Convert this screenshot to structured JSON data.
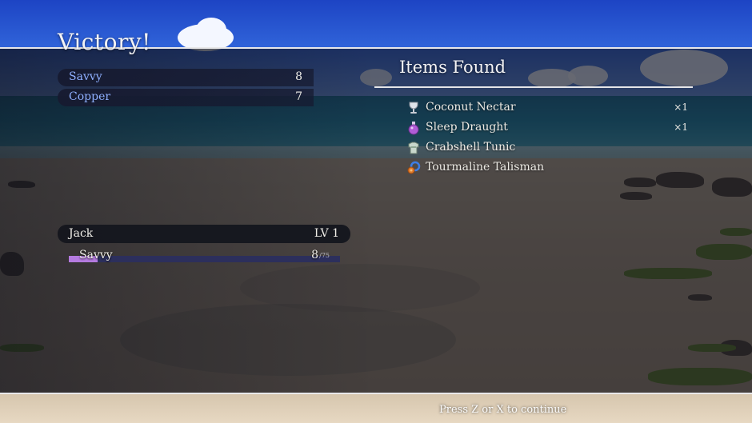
{
  "screen": {
    "title": "Victory!",
    "rewards": [
      {
        "label": "Savvy",
        "value": "8"
      },
      {
        "label": "Copper",
        "value": "7"
      }
    ],
    "items_found": {
      "title": "Items Found",
      "items": [
        {
          "name": "Coconut Nectar",
          "qty": "×1",
          "icon": "goblet-icon"
        },
        {
          "name": "Sleep Draught",
          "qty": "×1",
          "icon": "potion-icon"
        },
        {
          "name": "Crabshell Tunic",
          "qty": "",
          "icon": "armor-icon"
        },
        {
          "name": "Tourmaline Talisman",
          "qty": "",
          "icon": "talisman-icon"
        }
      ]
    },
    "character": {
      "name": "Jack",
      "level": "LV 1",
      "stat_label": "Savvy",
      "stat_current": "8",
      "stat_max": "/75",
      "stat_progress": 0.107
    },
    "hint": "Press Z or X to continue"
  },
  "colors": {
    "accent_label": "#8fb0ff",
    "bar_fill": "#b57be0",
    "bar_track": "#2c2f5c"
  }
}
